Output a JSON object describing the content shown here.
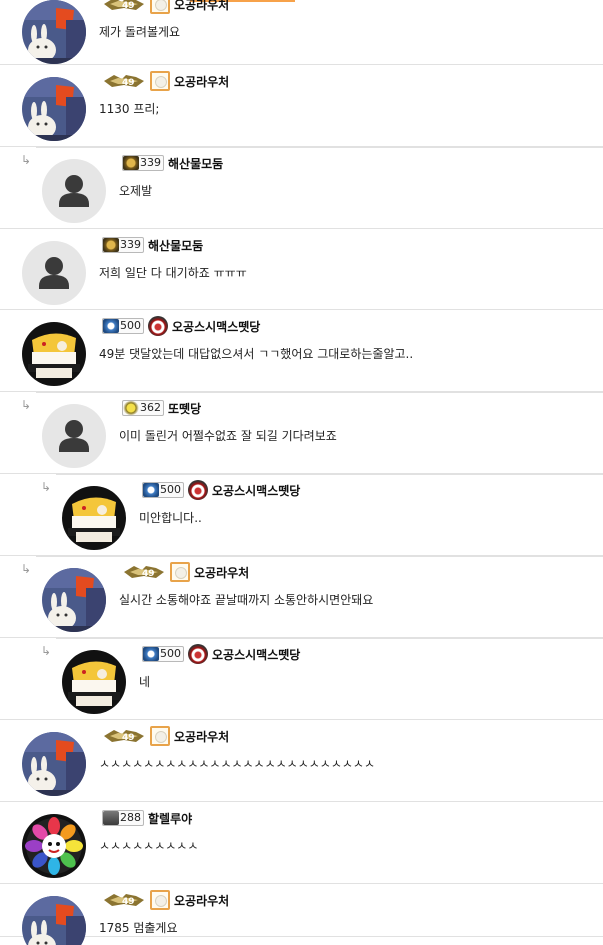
{
  "comments": [
    {
      "nickname": "오공라우처",
      "level": "",
      "badge": "wing-cert",
      "text": "제가 돌려볼게요",
      "reply_depth": 0,
      "avatar": "bunny"
    },
    {
      "nickname": "오공라우처",
      "level": "",
      "badge": "wing-cert",
      "text": "1130 프리;",
      "reply_depth": 0,
      "avatar": "bunny"
    },
    {
      "nickname": "해산물모둠",
      "level": "339",
      "badge": "gold",
      "text": "오제발",
      "reply_depth": 1,
      "avatar": "default"
    },
    {
      "nickname": "해산물모둠",
      "level": "339",
      "badge": "gold",
      "text": "저희 일단 다 대기하죠 ㅠㅠㅠ",
      "reply_depth": 0,
      "avatar": "default"
    },
    {
      "nickname": "오공스시맥스뗏당",
      "level": "500",
      "badge": "blue-pill",
      "text": "49분 댓달았는데 대답없으셔서 ㄱㄱ했어요 그대로하는줄알고..",
      "reply_depth": 0,
      "avatar": "sushi"
    },
    {
      "nickname": "또뗏당",
      "level": "362",
      "badge": "yellow",
      "text": "이미 돌린거 어쩔수없죠 잘 되길 기다려보죠",
      "reply_depth": 1,
      "avatar": "default"
    },
    {
      "nickname": "오공스시맥스뗏당",
      "level": "500",
      "badge": "blue-pill",
      "text": "미안합니다..",
      "reply_depth": 2,
      "avatar": "sushi"
    },
    {
      "nickname": "오공라우처",
      "level": "",
      "badge": "wing-cert",
      "text": "실시간 소통해야죠 끝날때까지 소통안하시면안돼요",
      "reply_depth": 1,
      "avatar": "bunny"
    },
    {
      "nickname": "오공스시맥스뗏당",
      "level": "500",
      "badge": "blue-pill",
      "text": "네",
      "reply_depth": 2,
      "avatar": "sushi"
    },
    {
      "nickname": "오공라우처",
      "level": "",
      "badge": "wing-cert",
      "text": "ㅅㅅㅅㅅㅅㅅㅅㅅㅅㅅㅅㅅㅅㅅㅅㅅㅅㅅㅅㅅㅅㅅㅅㅅㅅ",
      "reply_depth": 0,
      "avatar": "bunny"
    },
    {
      "nickname": "할렐루야",
      "level": "288",
      "badge": "dark",
      "text": "ㅅㅅㅅㅅㅅㅅㅅㅅㅅ",
      "reply_depth": 0,
      "avatar": "flower"
    },
    {
      "nickname": "오공라우처",
      "level": "",
      "badge": "wing-cert",
      "text": "1785 멈출게요",
      "reply_depth": 0,
      "avatar": "bunny"
    }
  ],
  "icons": {
    "reply_arrow": "↳",
    "reply_arrow_name": "reply-arrow-icon"
  },
  "colors": {
    "divider": "#e1e1e1",
    "accent": "#f7a24a"
  }
}
